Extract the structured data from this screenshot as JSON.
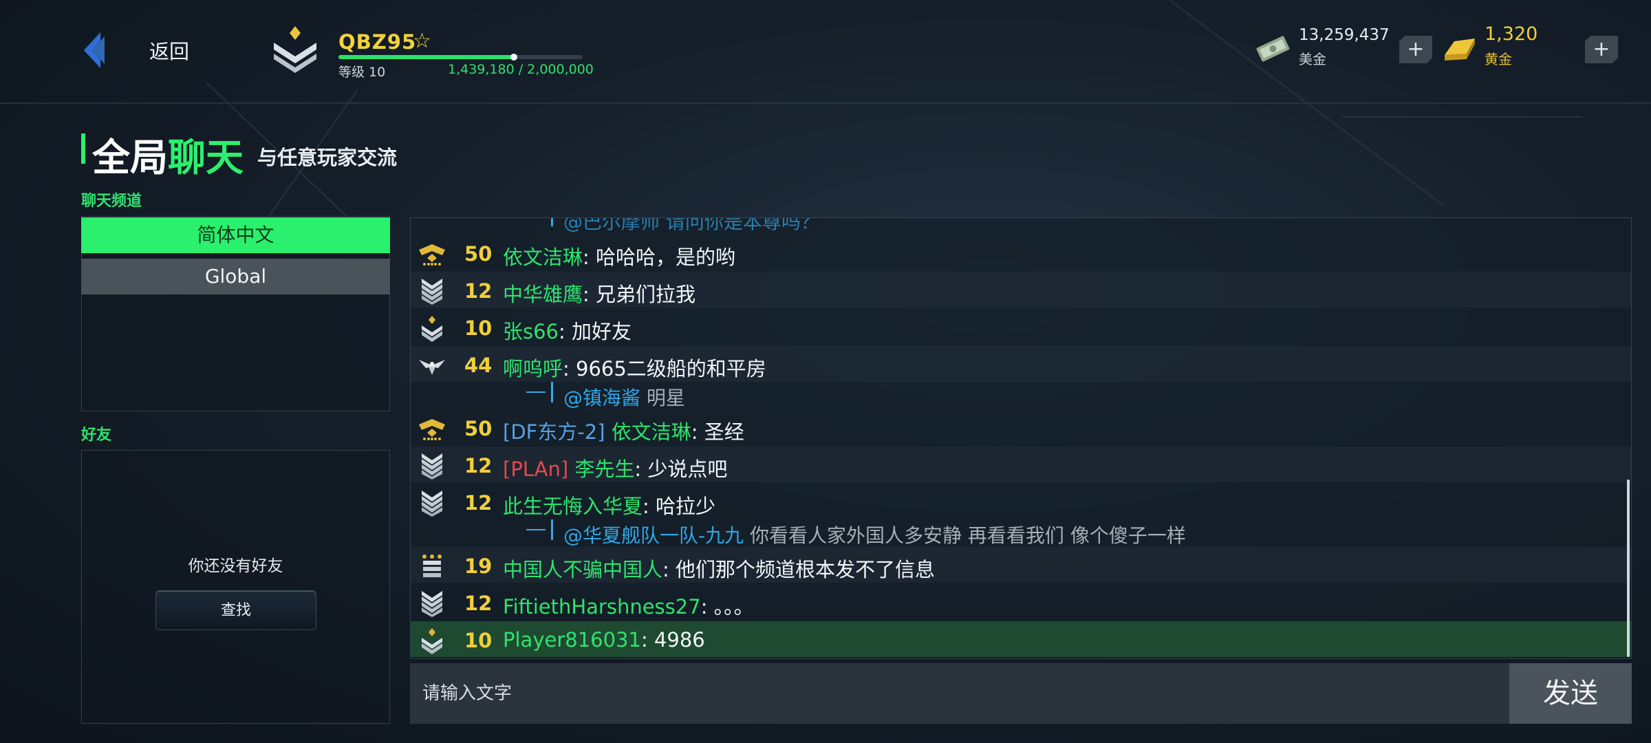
{
  "header": {
    "back_label": "返回",
    "player_name": "QBZ95",
    "level_label": "等级 10",
    "xp_text": "1,439,180 / 2,000,000",
    "xp_progress": 0.7196,
    "icons": [
      "back-chevron-icon",
      "rank-emblem-icon",
      "vip-star-icon",
      "cash-icon",
      "gold-bar-icon",
      "plus-icon"
    ]
  },
  "currency": {
    "cash_value": "13,259,437",
    "cash_label": "美金",
    "gold_value": "1,320",
    "gold_label": "黄金",
    "plus_symbol": "+"
  },
  "title": {
    "main_a": "全局",
    "main_b": "聊天",
    "subtitle": "与任意玩家交流"
  },
  "channels": {
    "section_label": "聊天频道",
    "items": [
      {
        "label": "简体中文",
        "active": true
      },
      {
        "label": "Global",
        "active": false
      }
    ]
  },
  "friends": {
    "section_label": "好友",
    "empty_text": "你还没有好友",
    "find_label": "查找"
  },
  "chat": {
    "partial_top": "@巴尔摩师  请问你是本尊吗？",
    "messages": [
      {
        "rank": "general-5",
        "level": "50",
        "name": "依文洁琳",
        "text": ": 哈哈哈，是的哟"
      },
      {
        "rank": "chevron-4",
        "level": "12",
        "name": "中华雄鹰",
        "text": ": 兄弟们拉我"
      },
      {
        "rank": "chevron-2",
        "level": "10",
        "name": "张s66",
        "text": ": 加好友"
      },
      {
        "rank": "eagle",
        "level": "44",
        "name": "啊呜呼",
        "text": ": 9665二级船的和平房",
        "reply_mention": "@镇海酱",
        "reply_quote": "明星"
      },
      {
        "rank": "general-5",
        "level": "50",
        "clan": "[DF东方-2]",
        "clan_color": "blue",
        "name": "依文洁琳",
        "text": ": 圣经"
      },
      {
        "rank": "chevron-4",
        "level": "12",
        "clan": "[PLAn]",
        "clan_color": "red",
        "name": "李先生",
        "text": ": 少说点吧"
      },
      {
        "rank": "chevron-4",
        "level": "12",
        "name": "此生无悔入华夏",
        "text": ": 哈拉少",
        "reply_mention": "@华夏舰队一队-九九",
        "reply_quote": "你看看人家外国人多安静  再看看我们  像个傻子一样"
      },
      {
        "rank": "bars-3",
        "level": "19",
        "name": "中国人不骗中国人",
        "text": ": 他们那个频道根本发不了信息"
      },
      {
        "rank": "chevron-4",
        "level": "12",
        "name": "FiftiethHarshness27",
        "text": ": 。。。"
      },
      {
        "rank": "chevron-2",
        "level": "10",
        "name": "Player816031",
        "text": ": 4986",
        "mine": true
      }
    ],
    "input_placeholder": "请输入文字",
    "send_label": "发送"
  },
  "colors": {
    "accent_green": "#2cf06d",
    "gold": "#f1cf3b",
    "mention_blue": "#33a6e6",
    "clan_red": "#e8474c"
  }
}
